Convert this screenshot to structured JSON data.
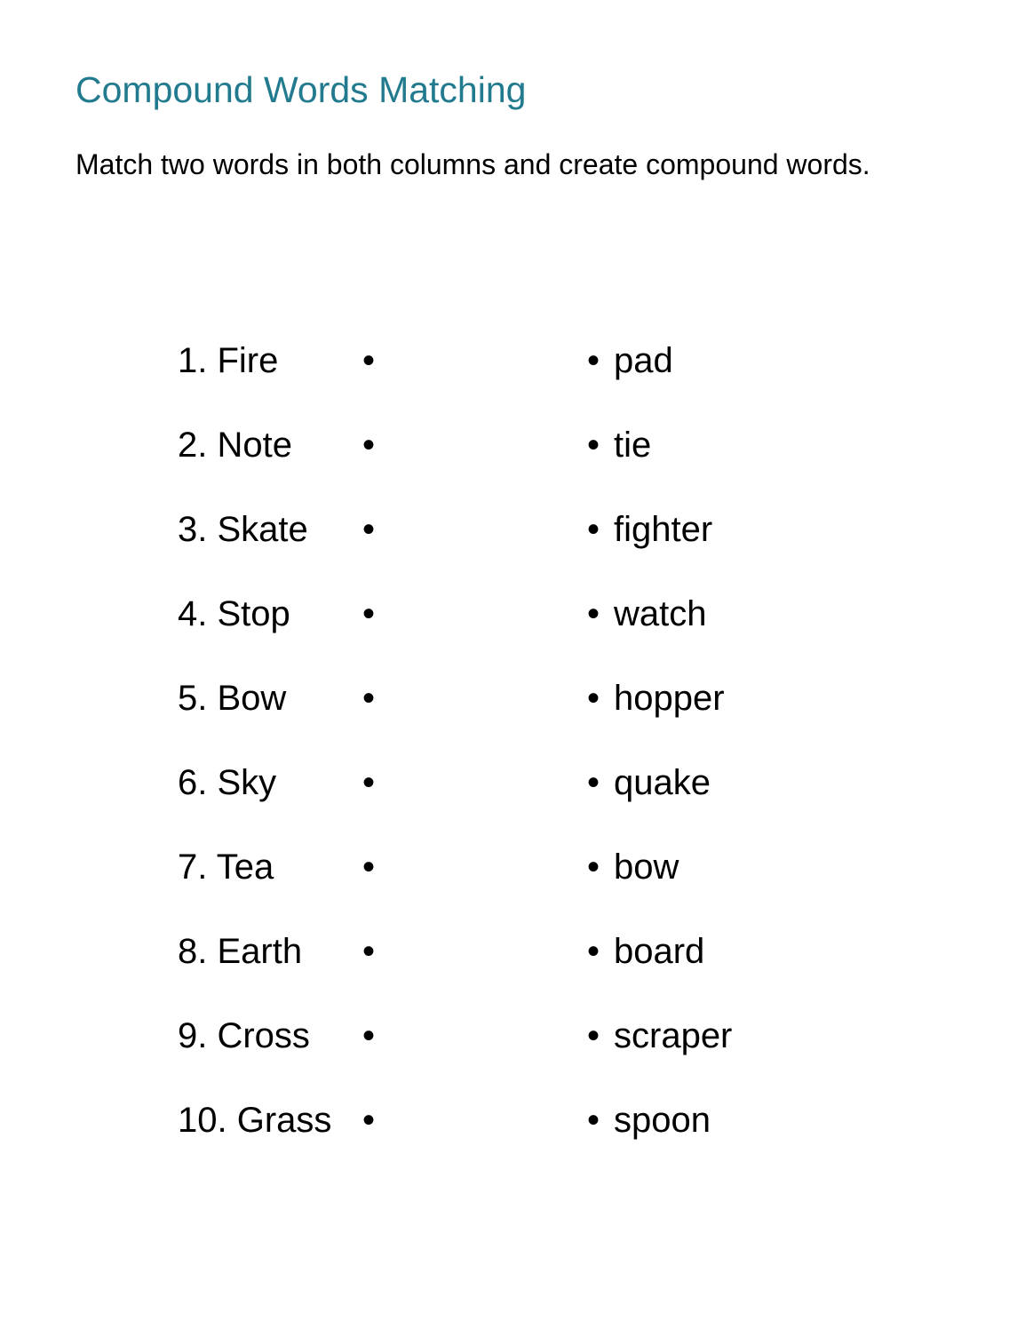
{
  "title": "Compound Words Matching",
  "instructions": "Match two words in both columns and create compound words.",
  "bullet": "•",
  "left_column": [
    "1. Fire",
    "2. Note",
    "3. Skate",
    "4. Stop",
    "5. Bow",
    "6. Sky",
    "7. Tea",
    "8. Earth",
    "9. Cross",
    "10. Grass"
  ],
  "right_column": [
    "pad",
    "tie",
    "fighter",
    "watch",
    "hopper",
    "quake",
    "bow",
    "board",
    "scraper",
    "spoon"
  ]
}
